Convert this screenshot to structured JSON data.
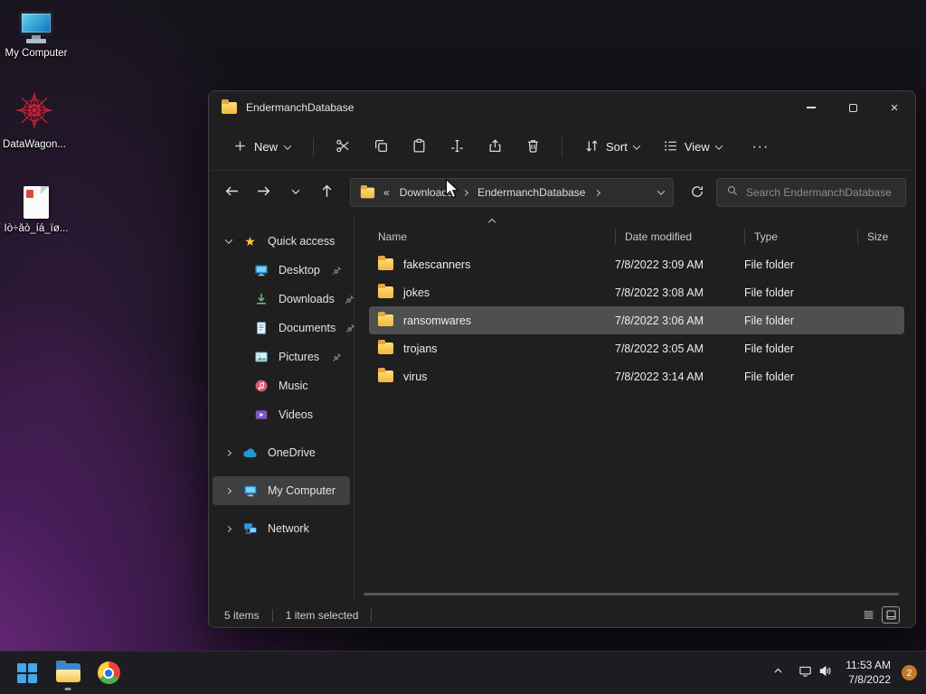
{
  "colors": {
    "folder_yellow": "#f6bd45",
    "selection_gray": "#4f4f4f",
    "accent_blue": "#43a7e8",
    "badge_orange": "#c17a2b"
  },
  "desktop": {
    "icons": [
      {
        "label": "My Computer"
      },
      {
        "label": "DataWagon..."
      },
      {
        "label": "Ìò÷åò_íá_ïø..."
      }
    ]
  },
  "window": {
    "title": "EndermanchDatabase",
    "toolbar": {
      "new_label": "New",
      "sort_label": "Sort",
      "view_label": "View",
      "more_label": "···"
    },
    "navbar": {
      "overflow": "«",
      "crumbs": [
        "Downloads",
        "EndermanchDatabase"
      ],
      "search_placeholder": "Search EndermanchDatabase"
    },
    "sidebar": {
      "items": [
        {
          "label": "Quick access"
        },
        {
          "label": "Desktop"
        },
        {
          "label": "Downloads"
        },
        {
          "label": "Documents"
        },
        {
          "label": "Pictures"
        },
        {
          "label": "Music"
        },
        {
          "label": "Videos"
        },
        {
          "label": "OneDrive"
        },
        {
          "label": "My Computer"
        },
        {
          "label": "Network"
        }
      ]
    },
    "files": {
      "columns": [
        "Name",
        "Date modified",
        "Type",
        "Size"
      ],
      "rows": [
        {
          "name": "fakescanners",
          "date_modified": "7/8/2022 3:09 AM",
          "type": "File folder",
          "size": ""
        },
        {
          "name": "jokes",
          "date_modified": "7/8/2022 3:08 AM",
          "type": "File folder",
          "size": ""
        },
        {
          "name": "ransomwares",
          "date_modified": "7/8/2022 3:06 AM",
          "type": "File folder",
          "size": ""
        },
        {
          "name": "trojans",
          "date_modified": "7/8/2022 3:05 AM",
          "type": "File folder",
          "size": ""
        },
        {
          "name": "virus",
          "date_modified": "7/8/2022 3:14 AM",
          "type": "File folder",
          "size": ""
        }
      ]
    },
    "statusbar": {
      "item_count": "5 items",
      "selection": "1 item selected"
    }
  },
  "taskbar": {
    "clock": {
      "time": "11:53 AM",
      "date": "7/8/2022"
    },
    "notification_count": "2"
  }
}
